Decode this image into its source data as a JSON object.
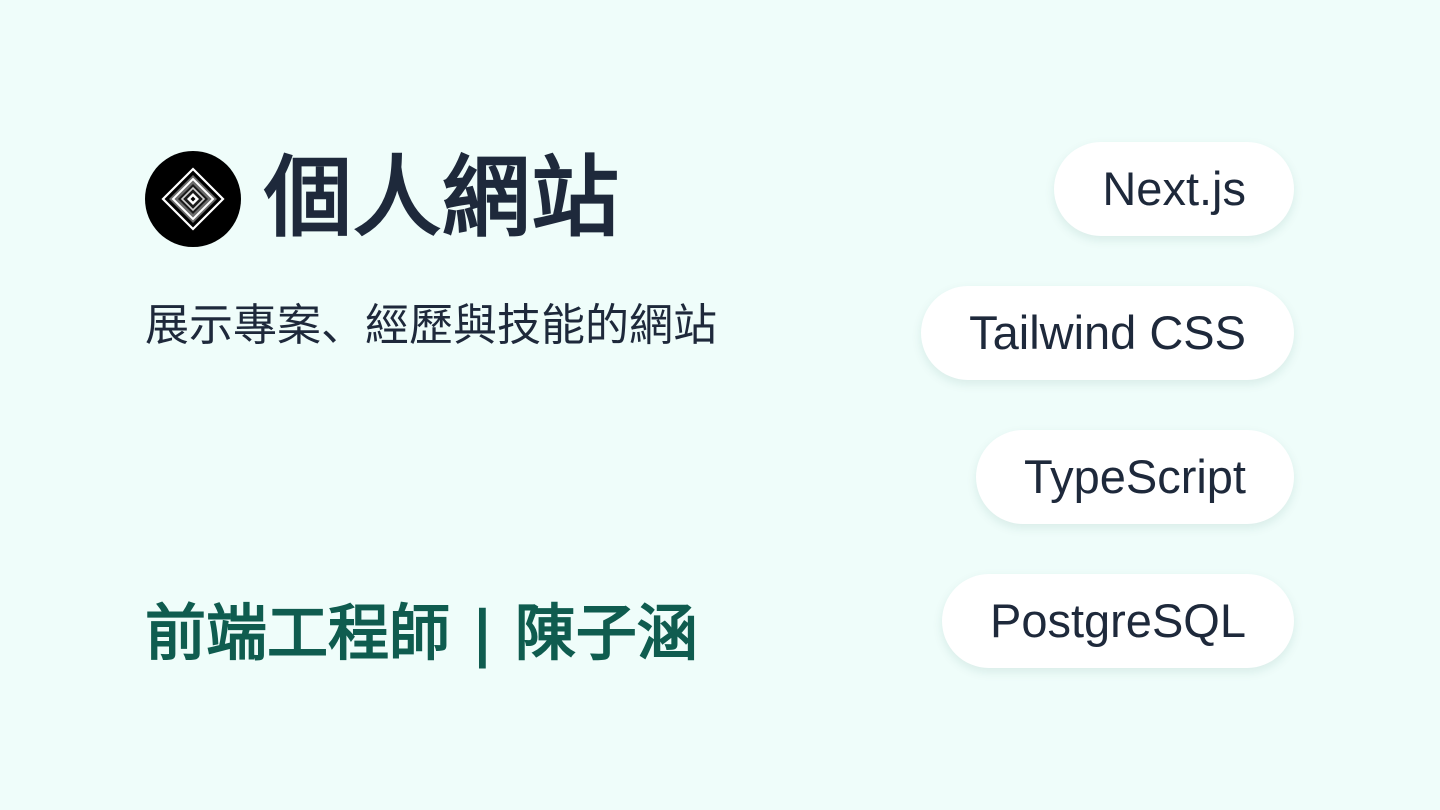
{
  "header": {
    "logo_icon": "diamond-logo-icon",
    "title": "個人網站",
    "subtitle": "展示專案、經歷與技能的網站"
  },
  "footer": {
    "role": "前端工程師 | 陳子涵"
  },
  "tags": [
    {
      "label": "Next.js"
    },
    {
      "label": "Tailwind CSS"
    },
    {
      "label": "TypeScript"
    },
    {
      "label": "PostgreSQL"
    }
  ],
  "colors": {
    "background": "#effdfa",
    "title_text": "#1e293b",
    "role_text": "#0f5c4f",
    "tag_background": "#ffffff",
    "logo_background": "#000000"
  }
}
